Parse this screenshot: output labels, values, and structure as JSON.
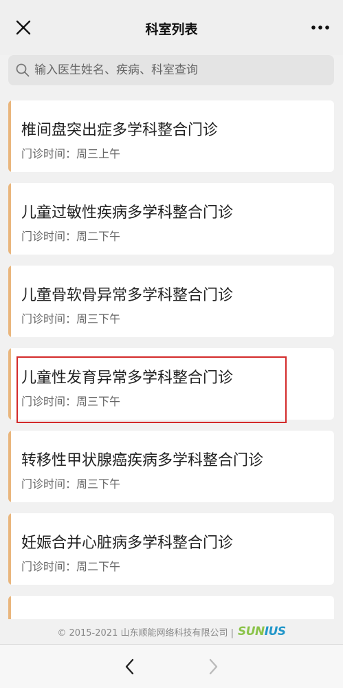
{
  "header": {
    "title": "科室列表",
    "close_icon": "close-icon",
    "more_icon": "more-dots-icon"
  },
  "search": {
    "placeholder": "输入医生姓名、疾病、科室查询",
    "icon": "search-icon"
  },
  "clinics": [
    {
      "name": "椎间盘突出症多学科整合门诊",
      "time_label": "门诊时间：",
      "time": "周三上午"
    },
    {
      "name": "儿童过敏性疾病多学科整合门诊",
      "time_label": "门诊时间：",
      "time": "周二下午"
    },
    {
      "name": "儿童骨软骨异常多学科整合门诊",
      "time_label": "门诊时间：",
      "time": "周三下午"
    },
    {
      "name": "儿童性发育异常多学科整合门诊",
      "time_label": "门诊时间：",
      "time": "周三下午"
    },
    {
      "name": "转移性甲状腺癌疾病多学科整合门诊",
      "time_label": "门诊时间：",
      "time": "周三下午"
    },
    {
      "name": "妊娠合并心脏病多学科整合门诊",
      "time_label": "门诊时间：",
      "time": "周二下午"
    }
  ],
  "footer": {
    "copyright": "© 2015-2021 山东顺能网络科技有限公司 |",
    "logo_text_a": "SUN",
    "logo_text_b": "IUS"
  },
  "navigation": {
    "back_icon": "chevron-left-icon",
    "forward_icon": "chevron-right-icon"
  },
  "colors": {
    "accent_bar": "#e9b67d",
    "highlight_border": "#d32a2a"
  }
}
